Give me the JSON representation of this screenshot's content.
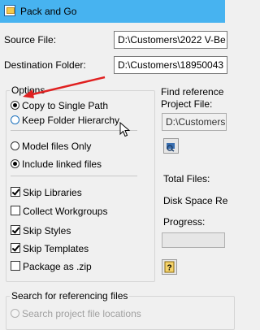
{
  "window": {
    "title": "Pack and Go"
  },
  "source": {
    "label": "Source File:",
    "value": "D:\\Customers\\2022 V-Be"
  },
  "destination": {
    "label": "Destination Folder:",
    "value": "D:\\Customers\\18950043"
  },
  "options": {
    "title": "Options",
    "copy_single": "Copy to Single Path",
    "keep_hierarchy": "Keep Folder Hierarchy",
    "model_only": "Model files Only",
    "include_linked": "Include linked files",
    "skip_libraries": "Skip Libraries",
    "collect_workgroups": "Collect Workgroups",
    "skip_styles": "Skip Styles",
    "skip_templates": "Skip Templates",
    "package_zip": "Package as .zip"
  },
  "find_refs": {
    "title": "Find reference",
    "project_label": "Project File:",
    "project_value": "D:\\Customers"
  },
  "stats": {
    "total_files": "Total Files:",
    "disk_space": "Disk Space Re",
    "progress": "Progress:"
  },
  "search": {
    "title": "Search for referencing files",
    "option": "Search project file locations"
  },
  "colors": {
    "titlebar": "#47b3f0",
    "arrow": "#e02020",
    "accent": "#1e73be"
  },
  "icons": {
    "app": "pack-and-go-icon",
    "browse": "browse-folder-icon",
    "help": "help-icon"
  }
}
